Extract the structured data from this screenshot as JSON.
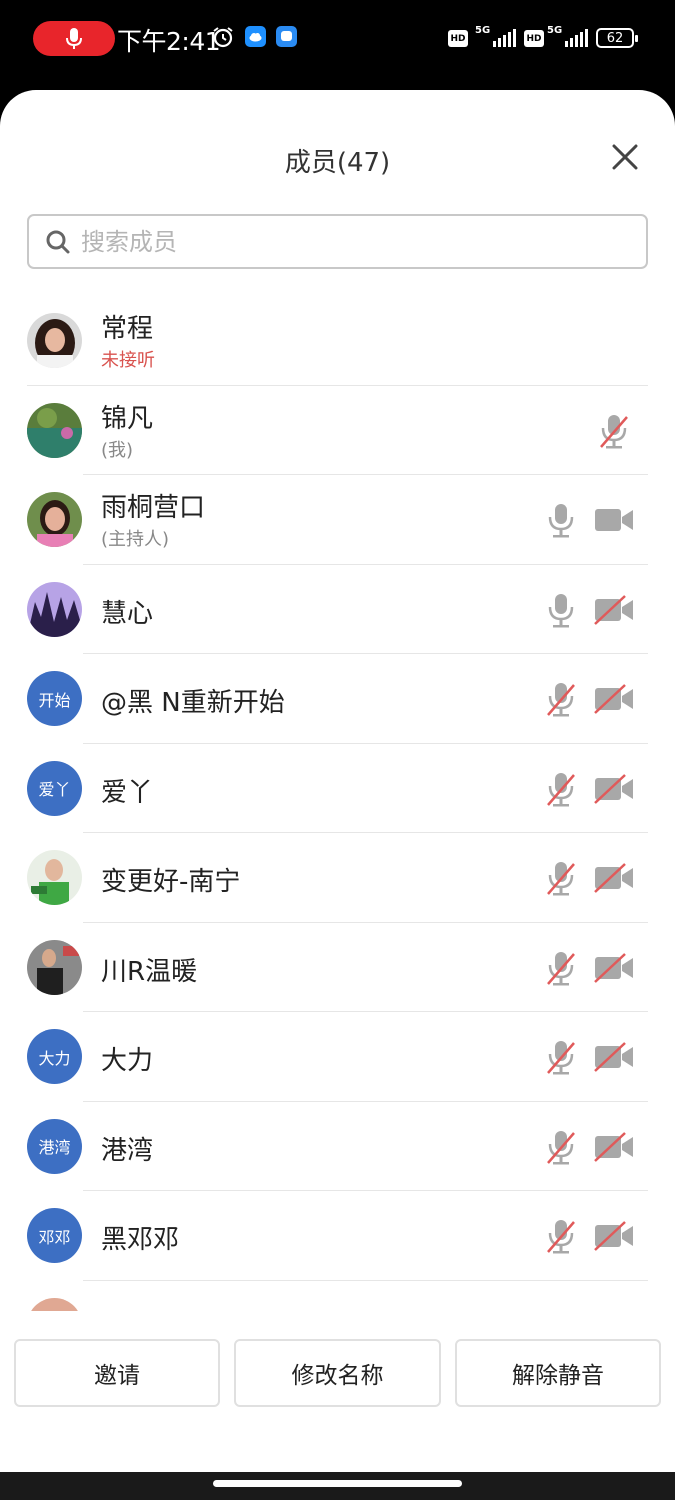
{
  "status_bar": {
    "time": "下午2:41",
    "battery": "62",
    "hd_1": "HD",
    "hd_2": "HD",
    "net_1": "5G",
    "net_2": "5G"
  },
  "sheet": {
    "title": "成员(47)",
    "search_placeholder": "搜索成员"
  },
  "members": [
    {
      "name": "常程",
      "sub": "未接听",
      "sub_style": "red",
      "avatar_type": "photo",
      "mic": "none",
      "cam": "none"
    },
    {
      "name": "锦凡",
      "sub": "(我)",
      "sub_style": "grey",
      "avatar_type": "photo",
      "mic": "muted",
      "cam": "none"
    },
    {
      "name": "雨桐营口",
      "sub": "(主持人)",
      "sub_style": "grey",
      "avatar_type": "photo",
      "mic": "on",
      "cam": "on"
    },
    {
      "name": "慧心",
      "sub": "",
      "avatar_type": "photo",
      "mic": "on",
      "cam": "off"
    },
    {
      "name": "@黑 N重新开始",
      "sub": "",
      "avatar_type": "text",
      "avatar_text": "开始",
      "mic": "muted",
      "cam": "off"
    },
    {
      "name": "爱丫",
      "sub": "",
      "avatar_type": "text",
      "avatar_text": "爱丫",
      "mic": "muted",
      "cam": "off"
    },
    {
      "name": "变更好-南宁",
      "sub": "",
      "avatar_type": "photo",
      "mic": "muted",
      "cam": "off"
    },
    {
      "name": "川R温暖",
      "sub": "",
      "avatar_type": "photo",
      "mic": "muted",
      "cam": "off"
    },
    {
      "name": "大力",
      "sub": "",
      "avatar_type": "text",
      "avatar_text": "大力",
      "mic": "muted",
      "cam": "off"
    },
    {
      "name": "港湾",
      "sub": "",
      "avatar_type": "text",
      "avatar_text": "港湾",
      "mic": "muted",
      "cam": "off"
    },
    {
      "name": "黑邓邓",
      "sub": "",
      "avatar_type": "text",
      "avatar_text": "邓邓",
      "mic": "muted",
      "cam": "off"
    }
  ],
  "actions": {
    "invite": "邀请",
    "rename": "修改名称",
    "unmute": "解除静音"
  },
  "colors": {
    "accent_avatar": "#3d6fc3",
    "muted_red": "#e05a5a",
    "record_red": "#e8252b"
  }
}
